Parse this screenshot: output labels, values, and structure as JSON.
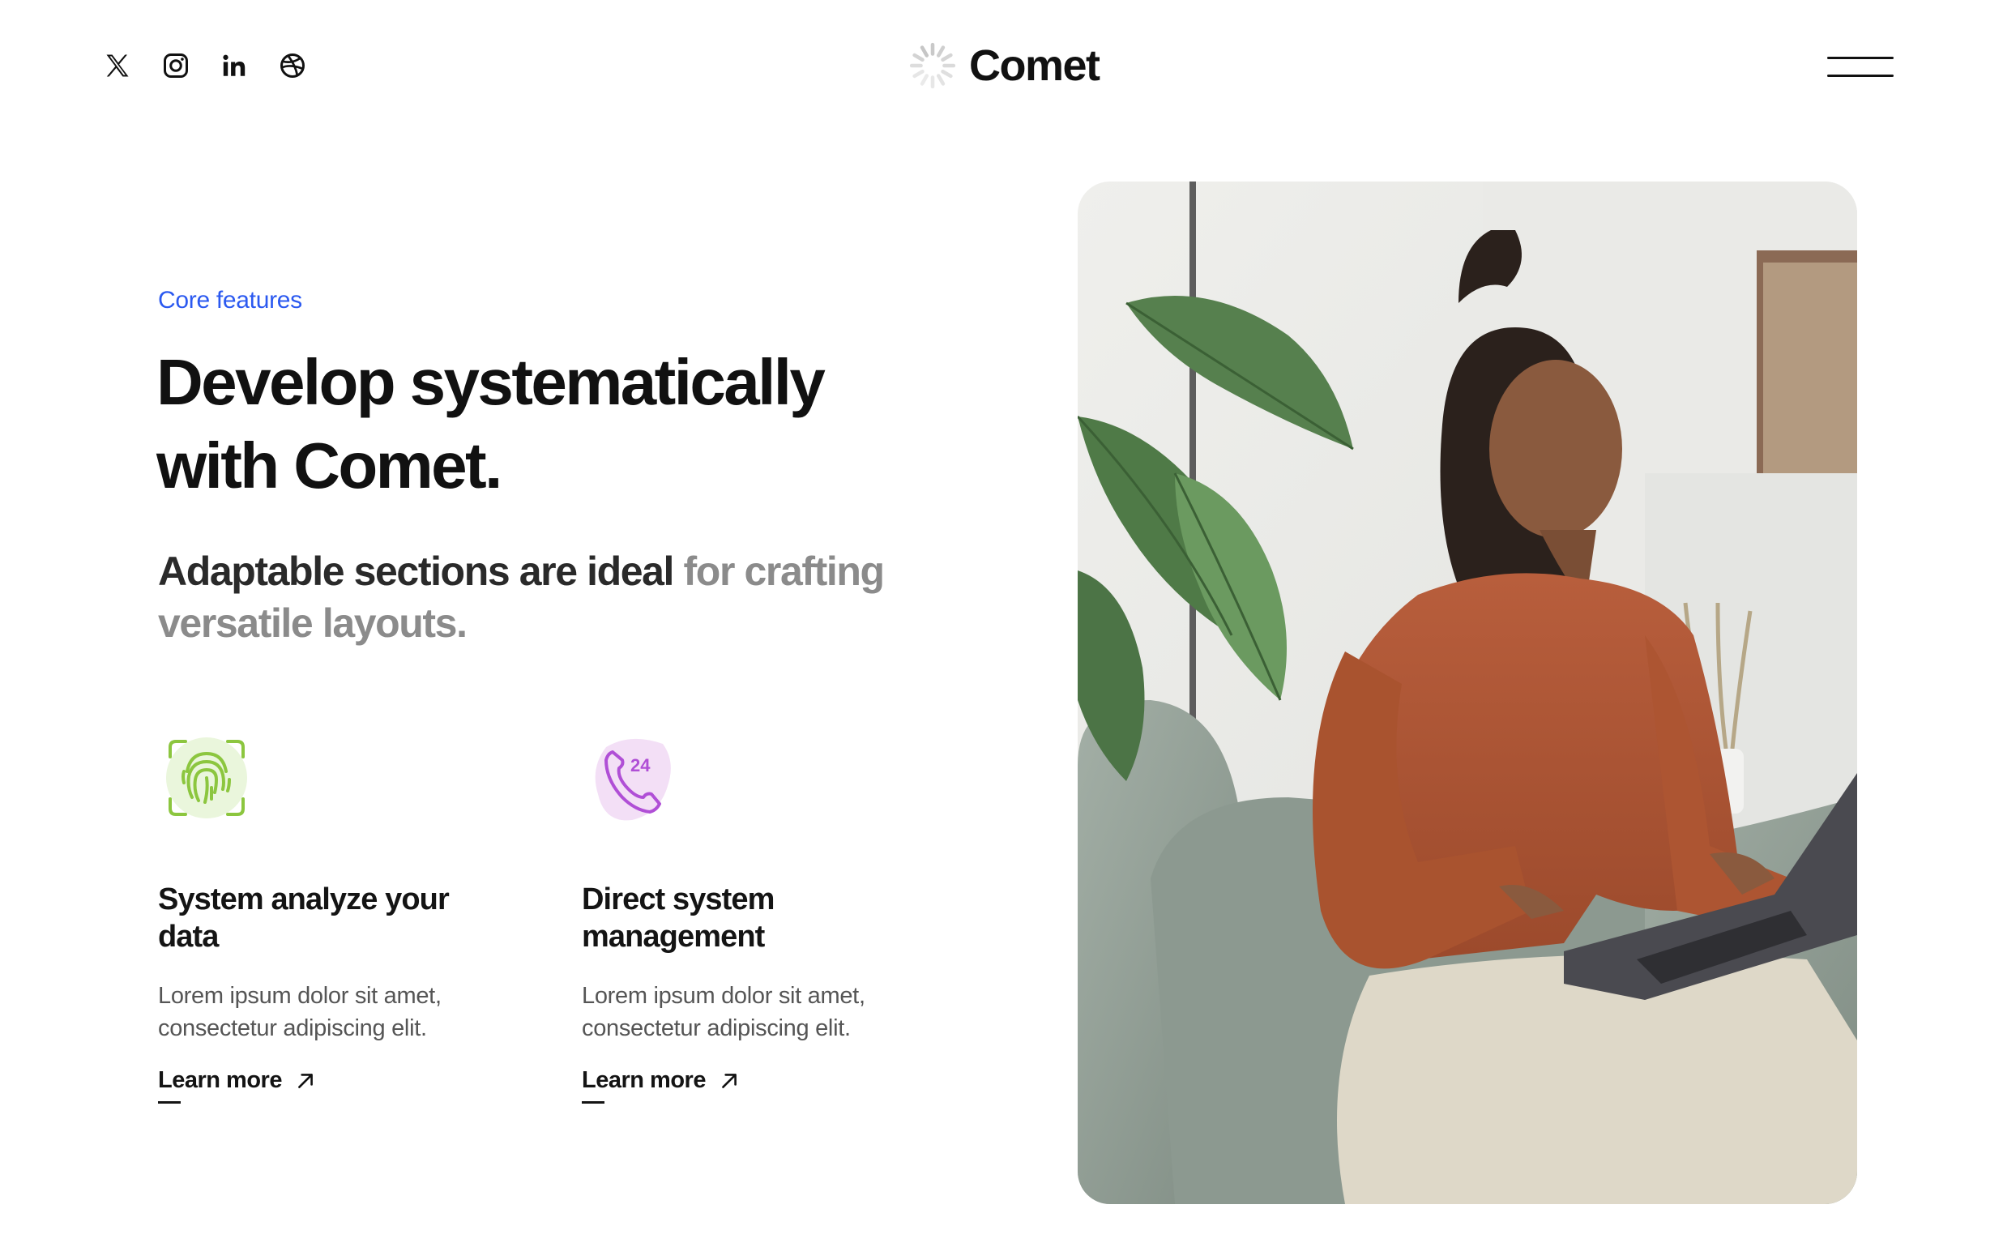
{
  "header": {
    "social": [
      {
        "icon": "x-twitter-icon",
        "label": "X"
      },
      {
        "icon": "instagram-icon",
        "label": "Instagram"
      },
      {
        "icon": "linkedin-icon",
        "label": "in"
      },
      {
        "icon": "dribbble-icon",
        "label": "Dribbble"
      }
    ],
    "brand": {
      "name": "Comet",
      "logo_icon": "comet-spinner-logo-icon"
    },
    "menu_icon": "hamburger-menu-icon"
  },
  "hero": {
    "eyebrow": "Core features",
    "headline_line1": "Develop systematically",
    "headline_line2": "with Comet.",
    "subline_dark": "Adaptable sections are ideal",
    "subline_muted": "for crafting versatile layouts.",
    "eyebrow_color": "#2b59f0"
  },
  "features": [
    {
      "icon": "fingerprint-scan-icon",
      "title": "System analyze your data",
      "text": "Lorem ipsum dolor sit amet, consectetur adipiscing elit.",
      "link": "Learn more",
      "accent": "#8cc63f"
    },
    {
      "icon": "phone-24-support-icon",
      "title": "Direct system management",
      "text": "Lorem ipsum dolor sit amet, consectetur adipiscing elit.",
      "link": "Learn more",
      "accent": "#b04fd6"
    }
  ],
  "photo": {
    "icon": "woman-with-laptop-photo"
  }
}
